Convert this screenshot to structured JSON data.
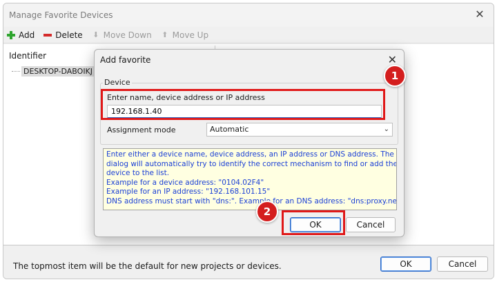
{
  "main": {
    "title": "Manage Favorite Devices",
    "close_glyph": "✕",
    "toolbar": {
      "add": "Add",
      "delete": "Delete",
      "move_down": "Move Down",
      "move_up": "Move Up"
    },
    "list": {
      "column_header": "Identifier",
      "items": [
        "DESKTOP-DABOIKJ"
      ]
    },
    "footer_text": "The topmost item will be the default for new projects or devices.",
    "ok_label": "OK",
    "cancel_label": "Cancel"
  },
  "dialog": {
    "title": "Add favorite",
    "close_glyph": "✕",
    "group_label": "Device",
    "field_label": "Enter name, device address or IP address",
    "field_value": "192.168.1.40",
    "assignment_label": "Assignment mode",
    "assignment_value": "Automatic",
    "info_lines": [
      "Enter either a device name, device address, an IP address or DNS address. The",
      "dialog will automatically try to identify the correct mechanism to find or add the",
      "device to the list.",
      "Example for a device address: \"0104.02F4\"",
      "Example for an IP address: \"192.168.101.15\"",
      "DNS address must start with \"dns:\". Example for an DNS address: \"dns:proxy.net\""
    ],
    "ok_label": "OK",
    "cancel_label": "Cancel"
  },
  "annotations": {
    "step1": "1",
    "step2": "2"
  },
  "colors": {
    "annotation_red": "#e01818",
    "info_text_blue": "#1a3fd6",
    "info_background": "#ffffe1",
    "add_icon_green": "#2fa52f",
    "delete_icon_red": "#d42a2a"
  }
}
